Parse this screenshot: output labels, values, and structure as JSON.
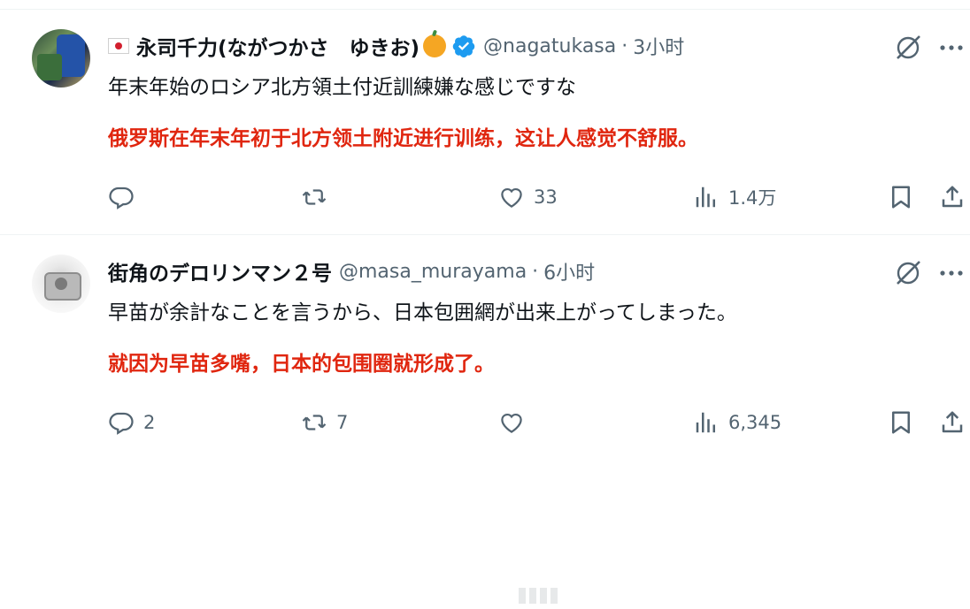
{
  "tweets": [
    {
      "name": "永司千力(ながつかさ　ゆきお)",
      "handle": "@nagatukasa",
      "dot": "·",
      "time": "3小时",
      "text_ja": "年末年始のロシア北方領土付近訓練嫌な感じですな",
      "text_cn": "俄罗斯在年末年初于北方领土附近进行训练，这让人感觉不舒服。",
      "reply_count": "",
      "retweet_count": "",
      "like_count": "33",
      "view_count": "1.4万",
      "has_flag": true,
      "badge_icon": "orange-icon",
      "verified": true
    },
    {
      "name": "街角のデロリンマン２号",
      "handle": "@masa_murayama",
      "dot": "·",
      "time": "6小时",
      "text_ja": "早苗が余計なことを言うから、日本包囲網が出来上がってしまった。",
      "text_cn": "就因为早苗多嘴，日本的包围圈就形成了。",
      "reply_count": "2",
      "retweet_count": "7",
      "like_count": "",
      "view_count": "6,345",
      "has_flag": false,
      "verified": false
    }
  ],
  "colors": {
    "text_primary": "#0f1419",
    "text_secondary": "#536471",
    "translation_red": "#e0260f",
    "verified_blue": "#1d9bf0"
  },
  "icons": [
    "reply-icon",
    "retweet-icon",
    "like-icon",
    "views-icon",
    "bookmark-icon",
    "share-icon",
    "grok-icon",
    "more-icon",
    "verified-icon"
  ]
}
